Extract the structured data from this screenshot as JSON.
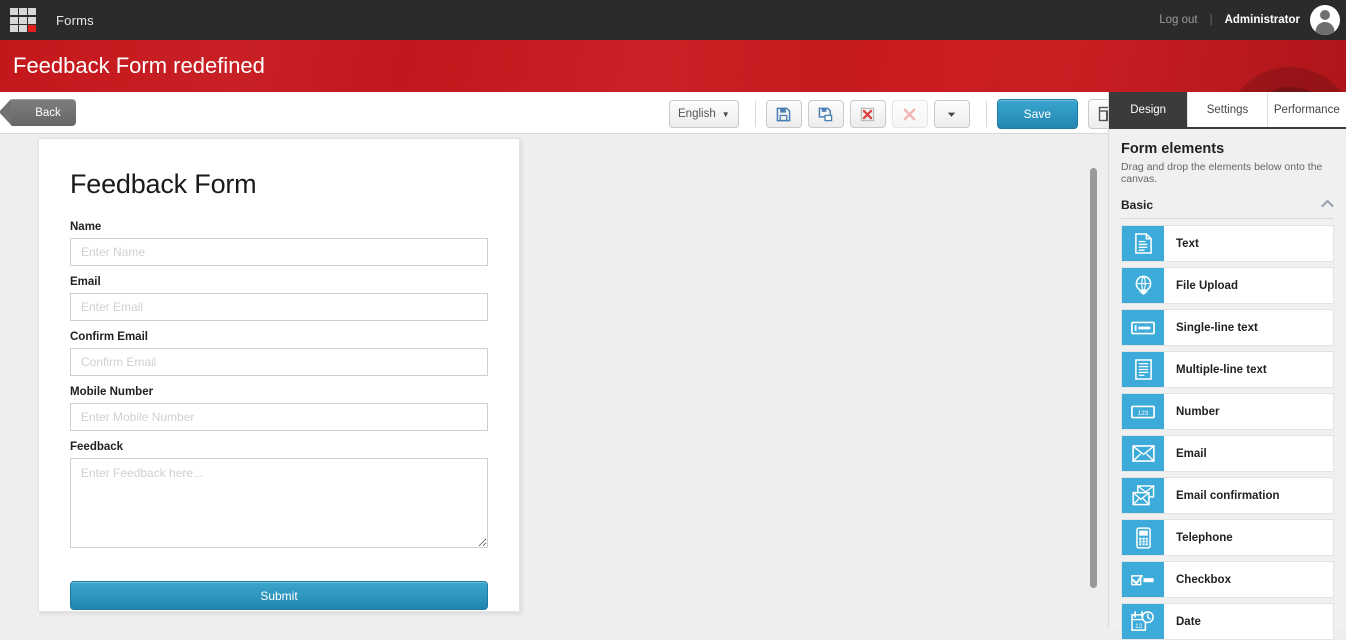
{
  "topbar": {
    "logo_icon": "grid-logo-icon",
    "app_name": "Forms",
    "logout_label": "Log out",
    "separator": "|",
    "admin_label": "Administrator",
    "avatar_icon": "user-avatar-icon"
  },
  "banner": {
    "title": "Feedback Form redefined",
    "color": "#c8191e"
  },
  "toolbar": {
    "back_label": "Back",
    "language_label": "English",
    "language_caret": "▼",
    "buttons": [
      {
        "name": "save-icon-button",
        "icon": "floppy-save-icon",
        "disabled": false
      },
      {
        "name": "save-as-icon-button",
        "icon": "floppy-save-as-icon",
        "disabled": false
      },
      {
        "name": "delete-icon-button",
        "icon": "grid-delete-icon",
        "disabled": false
      },
      {
        "name": "close-icon-button",
        "icon": "red-x-close-icon",
        "disabled": true
      },
      {
        "name": "more-options-button",
        "icon": "chevron-down-icon",
        "disabled": false
      }
    ],
    "save_label": "Save",
    "preview_icon": "panel-layout-icon"
  },
  "form": {
    "title": "Feedback Form",
    "fields": [
      {
        "label": "Name",
        "placeholder": "Enter Name",
        "type": "text",
        "name": "name"
      },
      {
        "label": "Email",
        "placeholder": "Enter Email",
        "type": "text",
        "name": "email"
      },
      {
        "label": "Confirm Email",
        "placeholder": "Confirm Email",
        "type": "text",
        "name": "confirm-email"
      },
      {
        "label": "Mobile Number",
        "placeholder": "Enter Mobile Number",
        "type": "text",
        "name": "mobile-number"
      },
      {
        "label": "Feedback",
        "placeholder": "Enter Feedback here...",
        "type": "textarea",
        "name": "feedback"
      }
    ],
    "submit_label": "Submit",
    "submit_color": "#2b93bf"
  },
  "right_panel": {
    "tabs": [
      {
        "label": "Design",
        "active": true
      },
      {
        "label": "Settings",
        "active": false
      },
      {
        "label": "Performance",
        "active": false
      }
    ],
    "heading": "Form elements",
    "subtitle": "Drag and drop the elements below onto the canvas.",
    "section_label": "Basic",
    "section_collapse_icon": "chevron-up-icon",
    "accent_color": "#3cabd9",
    "elements": [
      {
        "label": "Text",
        "icon": "document-text-icon"
      },
      {
        "label": "File Upload",
        "icon": "file-upload-globe-icon"
      },
      {
        "label": "Single-line text",
        "icon": "single-line-text-icon"
      },
      {
        "label": "Multiple-line text",
        "icon": "multiple-line-text-icon"
      },
      {
        "label": "Number",
        "icon": "number-123-icon"
      },
      {
        "label": "Email",
        "icon": "envelope-icon"
      },
      {
        "label": "Email confirmation",
        "icon": "double-envelope-icon"
      },
      {
        "label": "Telephone",
        "icon": "mobile-phone-icon"
      },
      {
        "label": "Checkbox",
        "icon": "checkbox-icon"
      },
      {
        "label": "Date",
        "icon": "calendar-clock-icon"
      }
    ]
  }
}
